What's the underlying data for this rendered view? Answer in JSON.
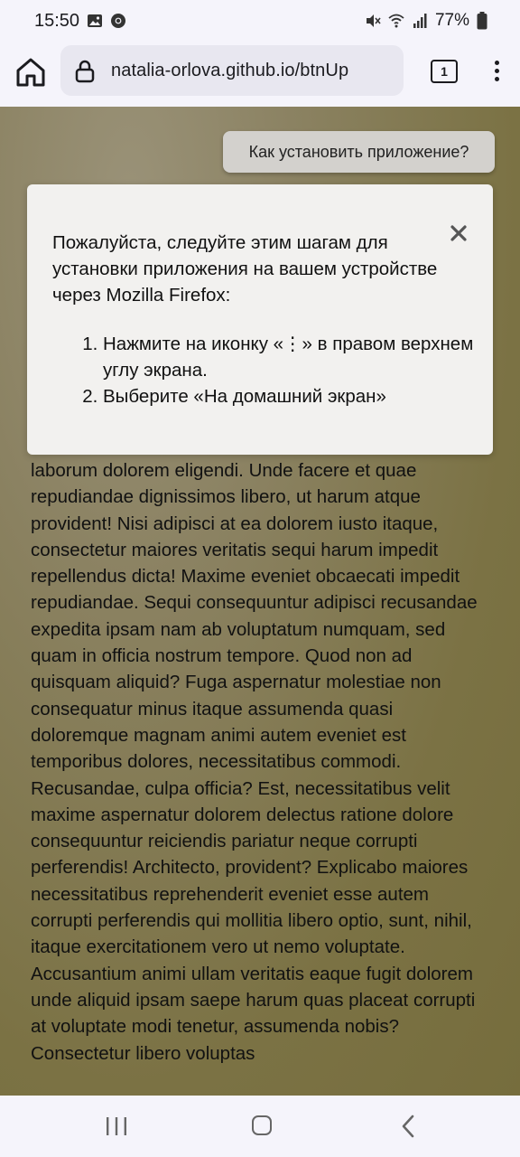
{
  "status_bar": {
    "time": "15:50",
    "battery_percent": "77%",
    "icons": [
      "image-icon",
      "chrome-icon",
      "mute-icon",
      "wifi-icon",
      "signal-icon",
      "battery-icon"
    ]
  },
  "browser": {
    "url": "natalia-orlova.github.io/btnUp",
    "tab_count": "1",
    "icons": [
      "home-icon",
      "lock-icon",
      "tabs-icon",
      "menu-icon"
    ]
  },
  "page": {
    "install_button_label": "Как установить приложение?",
    "body_text": "laborum dolorem eligendi. Unde facere et quae repudiandae dignissimos libero, ut harum atque provident! Nisi adipisci at ea dolorem iusto itaque, consectetur maiores veritatis sequi harum impedit repellendus dicta! Maxime eveniet obcaecati impedit repudiandae. Sequi consequuntur adipisci recusandae expedita ipsam nam ab voluptatum numquam, sed quam in officia nostrum tempore. Quod non ad quisquam aliquid? Fuga aspernatur molestiae non consequatur minus itaque assumenda quasi doloremque magnam animi autem eveniet est temporibus dolores, necessitatibus commodi. Recusandae, culpa officia? Est, necessitatibus velit maxime aspernatur dolorem delectus ratione dolore consequuntur reiciendis pariatur neque corrupti perferendis! Architecto, provident? Explicabo maiores necessitatibus reprehenderit eveniet esse autem corrupti perferendis qui mollitia libero optio, sunt, nihil, itaque exercitationem vero ut nemo voluptate. Accusantium animi ullam veritatis eaque fugit dolorem unde aliquid ipsam saepe harum quas placeat corrupti at voluptate modi tenetur, assumenda nobis? Consectetur libero voluptas"
  },
  "modal": {
    "intro": "Пожалуйста, следуйте этим шагам для установки приложения на вашем устройстве через Mozilla Firefox:",
    "steps": [
      "Нажмите на иконку «⋮» в правом верхнем углу экрана.",
      "Выберите «На домашний экран»"
    ],
    "close_icon": "close-icon"
  },
  "nav_bar": {
    "icons": [
      "recent-apps-icon",
      "home-icon",
      "back-icon"
    ]
  },
  "colors": {
    "content_background": "#7b7244",
    "modal_background": "#f2f1ef",
    "install_button_background": "#d3d1cd"
  }
}
